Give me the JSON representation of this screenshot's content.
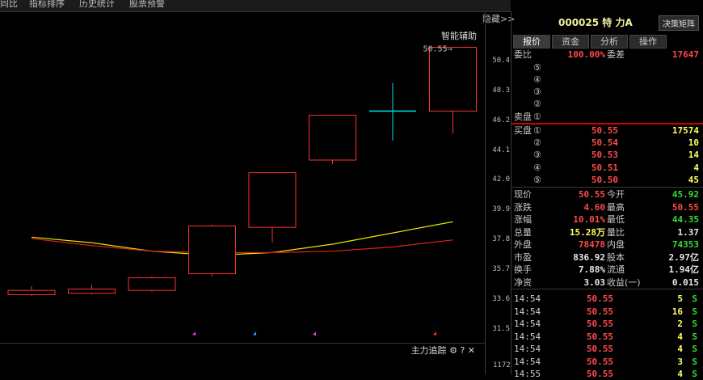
{
  "topmenu": [
    "同比",
    "指标排序",
    "历史统计",
    "股票预警"
  ],
  "chart": {
    "hide_label": "隐藏>>",
    "assist_label": "智能辅助",
    "max_label": "50.55→",
    "track_label": "主力追踪",
    "price_ticks": [
      "50.4",
      "48.3",
      "46.2",
      "44.1",
      "42.0",
      "39.9",
      "37.8",
      "35.7",
      "33.6",
      "31.5"
    ],
    "volume_tick": "1172",
    "colors": {
      "up": "#ff3030",
      "down": "#00e0e0",
      "ma_yellow": "#e6e600",
      "ma_red": "#e02020"
    }
  },
  "chart_data": {
    "type": "candlestick",
    "price_range": [
      30.5,
      51.5
    ],
    "candles": [
      {
        "open": 32.9,
        "close": 33.2,
        "high": 33.5,
        "low": 32.8
      },
      {
        "open": 33.0,
        "close": 33.3,
        "high": 33.6,
        "low": 32.9
      },
      {
        "open": 33.2,
        "close": 34.1,
        "high": 34.2,
        "low": 33.1
      },
      {
        "open": 34.4,
        "close": 37.8,
        "high": 37.9,
        "low": 34.2
      },
      {
        "open": 37.7,
        "close": 41.6,
        "high": 41.6,
        "low": 36.6
      },
      {
        "open": 42.5,
        "close": 45.7,
        "high": 45.7,
        "low": 42.2
      },
      {
        "open": 46.0,
        "close": 46.0,
        "high": 48.0,
        "low": 43.9
      },
      {
        "open": 46.0,
        "close": 50.55,
        "high": 50.55,
        "low": 44.4
      }
    ],
    "ma_yellow": [
      37.0,
      36.6,
      36.0,
      35.7,
      35.9,
      36.5,
      37.3,
      38.1
    ],
    "ma_red": [
      36.9,
      36.4,
      36.0,
      35.9,
      35.9,
      36.0,
      36.3,
      36.8
    ]
  },
  "quote": {
    "code": "000025 特  力A",
    "decision_btn": "决策矩阵",
    "tabs": [
      "报价",
      "资金",
      "分析",
      "操作"
    ],
    "weibi_label": "委比",
    "weibi": "100.00%",
    "weicha_label": "委差",
    "weicha": "17647",
    "sell_label": "卖盘",
    "buy_label": "买盘",
    "sell_levels": [
      "⑤",
      "④",
      "③",
      "②",
      "①"
    ],
    "buy_levels": [
      {
        "lv": "①",
        "price": "50.55",
        "vol": "17574"
      },
      {
        "lv": "②",
        "price": "50.54",
        "vol": "10"
      },
      {
        "lv": "③",
        "price": "50.53",
        "vol": "14"
      },
      {
        "lv": "④",
        "price": "50.51",
        "vol": "4"
      },
      {
        "lv": "⑤",
        "price": "50.50",
        "vol": "45"
      }
    ],
    "stats": [
      {
        "l1": "现价",
        "v1": "50.55",
        "c1": "red",
        "l2": "今开",
        "v2": "45.92",
        "c2": "green"
      },
      {
        "l1": "涨跌",
        "v1": "4.60",
        "c1": "red",
        "l2": "最高",
        "v2": "50.55",
        "c2": "red"
      },
      {
        "l1": "涨幅",
        "v1": "10.01%",
        "c1": "red",
        "l2": "最低",
        "v2": "44.35",
        "c2": "green"
      },
      {
        "l1": "总量",
        "v1": "15.28万",
        "c1": "yellow",
        "l2": "量比",
        "v2": "1.37",
        "c2": "white"
      },
      {
        "l1": "外盘",
        "v1": "78478",
        "c1": "red",
        "l2": "内盘",
        "v2": "74353",
        "c2": "green"
      },
      {
        "l1": "市盈",
        "v1": "836.92",
        "c1": "white",
        "l2": "股本",
        "v2": "2.97亿",
        "c2": "white"
      },
      {
        "l1": "换手",
        "v1": "7.88%",
        "c1": "white",
        "l2": "流通",
        "v2": "1.94亿",
        "c2": "white"
      },
      {
        "l1": "净资",
        "v1": "3.03",
        "c1": "white",
        "l2": "收益(一)",
        "v2": "0.015",
        "c2": "white"
      }
    ],
    "ticks": [
      {
        "time": "14:54",
        "price": "50.55",
        "vol": "5",
        "side": "S"
      },
      {
        "time": "14:54",
        "price": "50.55",
        "vol": "16",
        "side": "S"
      },
      {
        "time": "14:54",
        "price": "50.55",
        "vol": "2",
        "side": "S"
      },
      {
        "time": "14:54",
        "price": "50.55",
        "vol": "4",
        "side": "S"
      },
      {
        "time": "14:54",
        "price": "50.55",
        "vol": "4",
        "side": "S"
      },
      {
        "time": "14:54",
        "price": "50.55",
        "vol": "3",
        "side": "S"
      },
      {
        "time": "14:55",
        "price": "50.55",
        "vol": "4",
        "side": "S"
      }
    ]
  }
}
